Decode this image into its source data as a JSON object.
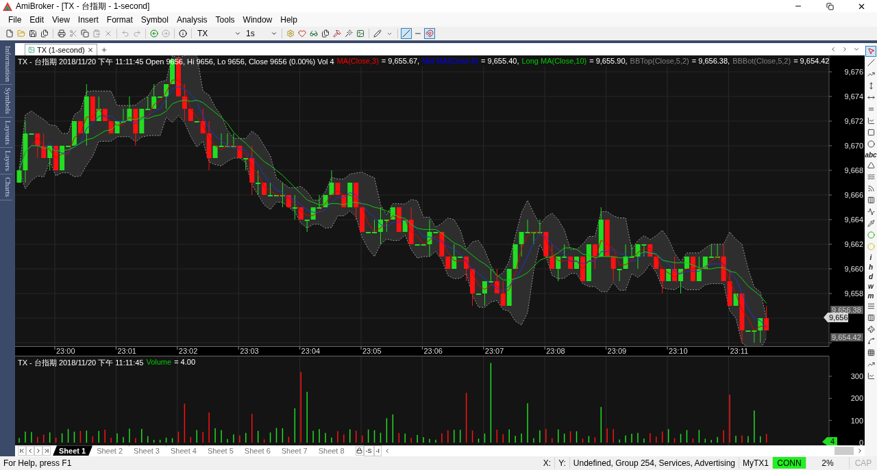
{
  "window": {
    "title": "AmiBroker - [TX - 台指期 - 1-second]"
  },
  "menu": [
    "File",
    "Edit",
    "View",
    "Insert",
    "Format",
    "Symbol",
    "Analysis",
    "Tools",
    "Window",
    "Help"
  ],
  "toolbar": {
    "symbol": "TX",
    "interval": "1s"
  },
  "sidebar": [
    "Information",
    "Symbols",
    "Layouts",
    "Layers",
    "Charts"
  ],
  "tabs": [
    {
      "label": "TX (1-second)",
      "selected": true
    }
  ],
  "price_pane": {
    "legend": [
      {
        "text": "TX - 台指期 2018/11/20 下午 11:11:45 Open 9656, Hi 9656, Lo 9656, Close 9656 (0.00%) Vol 4",
        "color": "#ffffff"
      },
      {
        "text": "MA(Close,3)",
        "color": "#ff0000"
      },
      {
        "text": "= 9,655.67,",
        "color": "#ffffff"
      },
      {
        "text": "Mid MA(Close,5)",
        "color": "#0000ff"
      },
      {
        "text": "= 9,655.40,",
        "color": "#ffffff"
      },
      {
        "text": "Long MA(Close,10)",
        "color": "#00cc00"
      },
      {
        "text": "= 9,655.90,",
        "color": "#ffffff"
      },
      {
        "text": "BBTop(Close,5,2)",
        "color": "#808080"
      },
      {
        "text": "= 9,656.38,",
        "color": "#ffffff"
      },
      {
        "text": "BBBot(Close,5,2)",
        "color": "#808080"
      },
      {
        "text": "= 9,654.42",
        "color": "#ffffff"
      }
    ],
    "y_ticks": [
      "9,676",
      "9,674",
      "9,672",
      "9,670",
      "9,668",
      "9,666",
      "9,664",
      "9,662",
      "9,660",
      "9,658"
    ],
    "markers": [
      {
        "kind": "band",
        "text": "9,656.38"
      },
      {
        "kind": "last",
        "text": "9,656"
      },
      {
        "kind": "band",
        "text": "9,654.42"
      }
    ]
  },
  "time_axis": [
    "23:00",
    "23:01",
    "23:02",
    "23:03",
    "23:04",
    "23:05",
    "23:06",
    "23:07",
    "23:08",
    "23:09",
    "23:10",
    "23:11"
  ],
  "volume_pane": {
    "legend": [
      {
        "text": "TX - 台指期  2018/11/20 下午 11:11:45",
        "color": "#ffffff"
      },
      {
        "text": "Volume",
        "color": "#00cc00"
      },
      {
        "text": "= 4.00",
        "color": "#ffffff"
      }
    ],
    "y_ticks": [
      "300",
      "200",
      "100",
      "0"
    ],
    "marker": "4"
  },
  "right_toolbar": {
    "text_tool": "abc",
    "letter_tools": [
      "i",
      "h",
      "d",
      "w",
      "m"
    ]
  },
  "sheets": [
    {
      "label": "Sheet 1",
      "selected": true
    },
    {
      "label": "Sheet 2",
      "selected": false
    },
    {
      "label": "Sheet 3",
      "selected": false
    },
    {
      "label": "Sheet 4",
      "selected": false
    },
    {
      "label": "Sheet 5",
      "selected": false
    },
    {
      "label": "Sheet 6",
      "selected": false
    },
    {
      "label": "Sheet 7",
      "selected": false
    },
    {
      "label": "Sheet 8",
      "selected": false
    }
  ],
  "sheet_buttons": [
    "-S",
    "-I"
  ],
  "status_bar": {
    "help": "For Help, press F1",
    "x": "X:",
    "y": "Y:",
    "info": "Undefined, Group 254, Services, Advertising",
    "database": "MyTX1",
    "connection": {
      "label": "CONN",
      "connected": true
    },
    "cpu": "2%",
    "caps": {
      "label": "CAP",
      "on": false
    }
  }
}
